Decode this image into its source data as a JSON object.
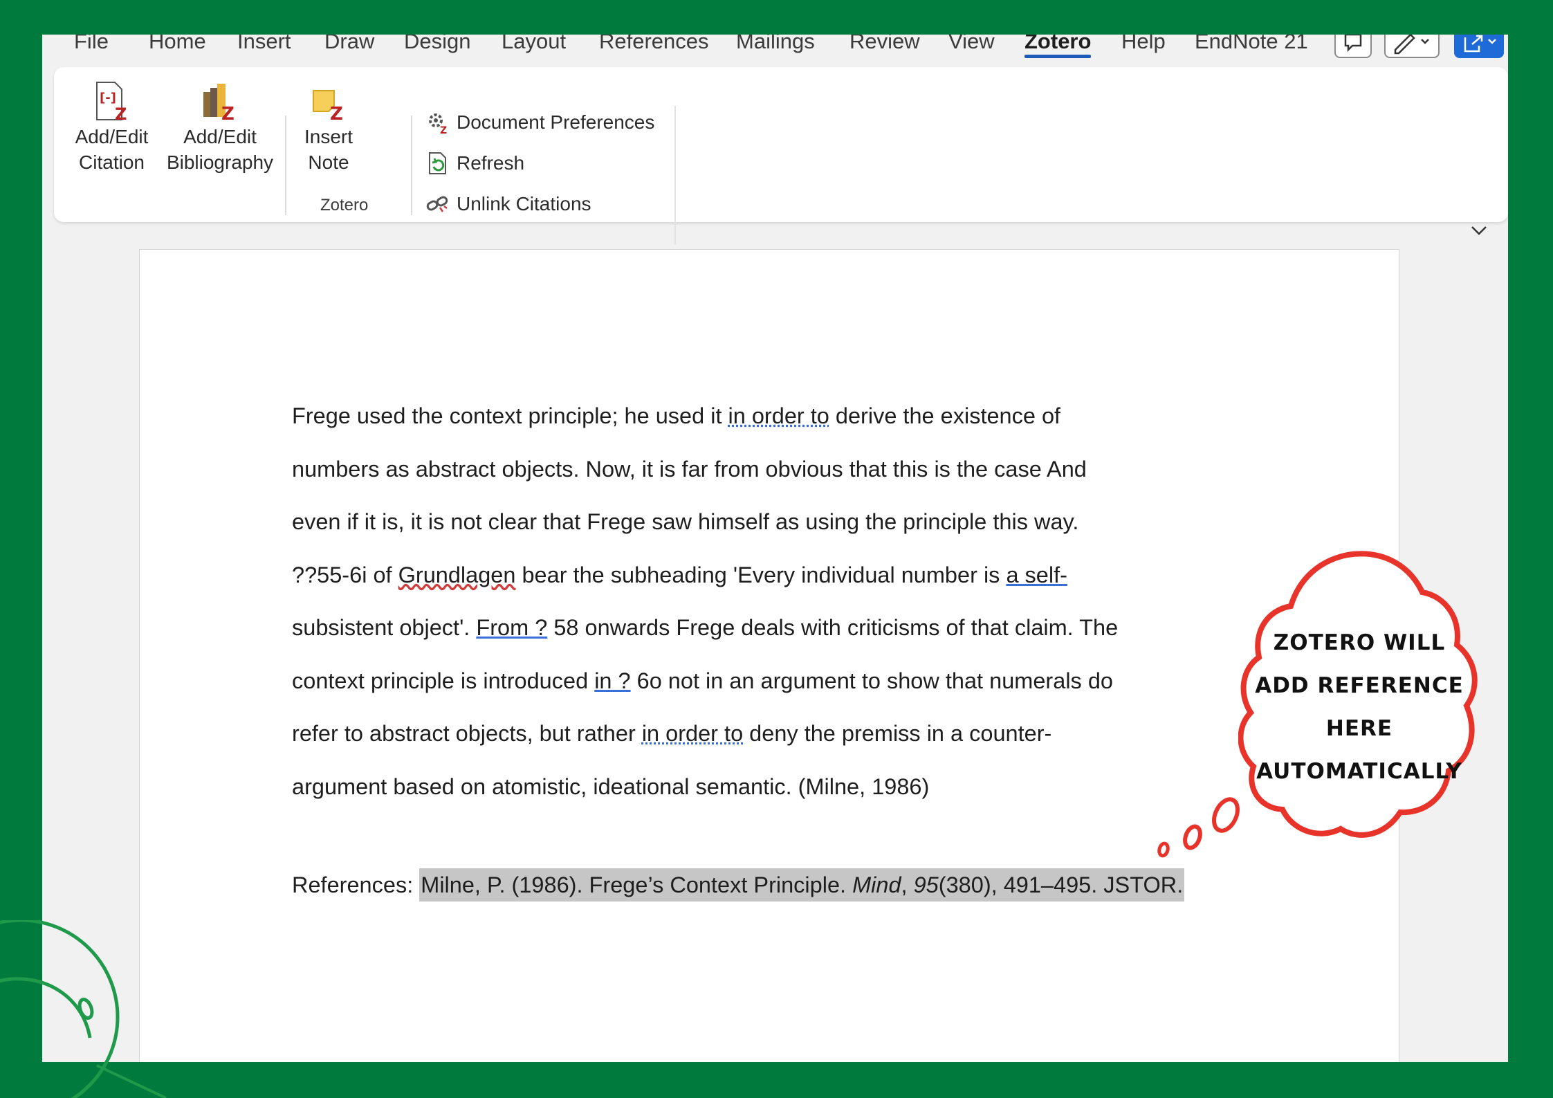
{
  "tabs": [
    "File",
    "Home",
    "Insert",
    "Draw",
    "Design",
    "Layout",
    "References",
    "Mailings",
    "Review",
    "View",
    "Zotero",
    "Help",
    "EndNote 21"
  ],
  "active_tab": "Zotero",
  "ribbon": {
    "add_citation": {
      "line1": "Add/Edit",
      "line2": "Citation",
      "icon": "zotero-citation-icon"
    },
    "add_bibliography": {
      "line1": "Add/Edit",
      "line2": "Bibliography",
      "icon": "zotero-bibliography-icon"
    },
    "insert_note": {
      "line1": "Insert",
      "line2": "Note",
      "icon": "zotero-note-icon"
    },
    "document_preferences": "Document Preferences",
    "refresh": "Refresh",
    "unlink_citations": "Unlink Citations",
    "group_label": "Zotero"
  },
  "document": {
    "lines": [
      [
        "Frege used the context principle; he used it ",
        "in order to",
        " derive the existence of"
      ],
      [
        "numbers as abstract objects. Now, it is far from obvious that this is the case And"
      ],
      [
        "even if it is, it is not clear that Frege saw himself as using the principle this way."
      ],
      [
        "??55-6i of ",
        "Grundlagen",
        " bear the subheading 'Every individual number is ",
        "a self-"
      ],
      [
        "subsistent object'. ",
        "From ?",
        " 58 onwards Frege deals with criticisms of that claim. The"
      ],
      [
        "context principle is introduced ",
        "in ?",
        " 6o not in an argument to show that numerals do"
      ],
      [
        "refer to abstract objects, but rather ",
        "in order to",
        " deny the premiss in a counter-"
      ],
      [
        "argument based on atomistic, ideational semantic. (Milne, 1986)"
      ]
    ],
    "references_label": "References: ",
    "reference": {
      "pre": "Milne, P. (1986). Frege’s Context Principle. ",
      "journal": "Mind",
      "sep": ", ",
      "volume": "95",
      "post": "(380), 491–495. JSTOR."
    }
  },
  "callout": [
    "ZOTERO WILL",
    "ADD REFERENCE",
    "HERE",
    "AUTOMATICALLY"
  ],
  "colors": {
    "background": "#007a3d",
    "callout_outline": "#e8332a",
    "active_tab_underline": "#1e5bb8",
    "reference_highlight": "#c6c6c6"
  }
}
